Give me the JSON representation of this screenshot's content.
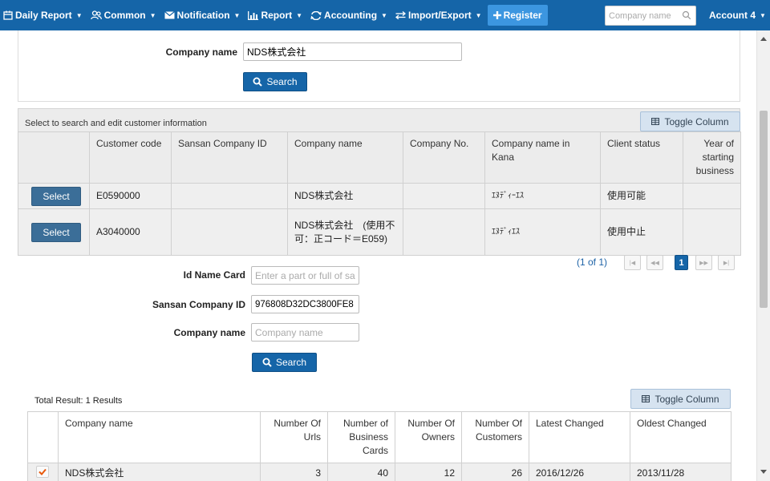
{
  "navbar": {
    "items": [
      {
        "label": "Daily Report",
        "icon": "calendar-icon"
      },
      {
        "label": "Common",
        "icon": "users-icon"
      },
      {
        "label": "Notification",
        "icon": "envelope-icon"
      },
      {
        "label": "Report",
        "icon": "bar-chart-icon"
      },
      {
        "label": "Accounting",
        "icon": "exchange-icon"
      },
      {
        "label": "Import/Export",
        "icon": "swap-icon"
      }
    ],
    "register_label": "Register",
    "search_placeholder": "Company name",
    "account_label": "Account 4"
  },
  "top_search": {
    "company_label": "Company name",
    "company_value": "NDS株式会社",
    "search_label": "Search"
  },
  "customer_panel": {
    "caption": "Select to search and edit customer information",
    "toggle_label": "Toggle Column",
    "columns": [
      "",
      "Customer code",
      "Sansan Company ID",
      "Company name",
      "Company No.",
      "Company name in Kana",
      "Client status",
      "Year of starting business"
    ],
    "rows": [
      {
        "select": "Select",
        "code": "E0590000",
        "sansan_id": "",
        "name": "NDS株式会社",
        "company_no": "",
        "kana": "ｴﾇﾃﾞｨｰｴｽ",
        "status": "使用可能",
        "year": ""
      },
      {
        "select": "Select",
        "code": "A3040000",
        "sansan_id": "",
        "name": "NDS株式会社　(使用不可：正コード＝E059)",
        "company_no": "",
        "kana": "ｴﾇﾃﾞｨｴｽ",
        "status": "使用中止",
        "year": ""
      }
    ],
    "pager": {
      "text": "(1 of 1)",
      "current_page": "1"
    }
  },
  "search_form": {
    "id_name_card_label": "Id Name Card",
    "id_name_card_placeholder": "Enter a part or full of same",
    "sansan_id_label": "Sansan Company ID",
    "sansan_id_value": "976808D32DC3800FE8",
    "company_label": "Company name",
    "company_placeholder": "Company name",
    "search_label": "Search"
  },
  "results": {
    "caption": "Total Result: 1 Results",
    "toggle_label": "Toggle Column",
    "columns": [
      "",
      "Company name",
      "Number Of Urls",
      "Number of Business Cards",
      "Number Of Owners",
      "Number Of Customers",
      "Latest Changed",
      "Oldest Changed"
    ],
    "rows": [
      {
        "checked": true,
        "name": "NDS株式会社",
        "urls": "3",
        "cards": "40",
        "owners": "12",
        "customers": "26",
        "latest": "2016/12/26",
        "oldest": "2013/11/28"
      }
    ]
  },
  "colors": {
    "navbar": "#1565a8",
    "register": "#3c96e0",
    "select_button": "#3b6e98",
    "check": "#e8590c",
    "pager_text": "#1d62a6"
  }
}
